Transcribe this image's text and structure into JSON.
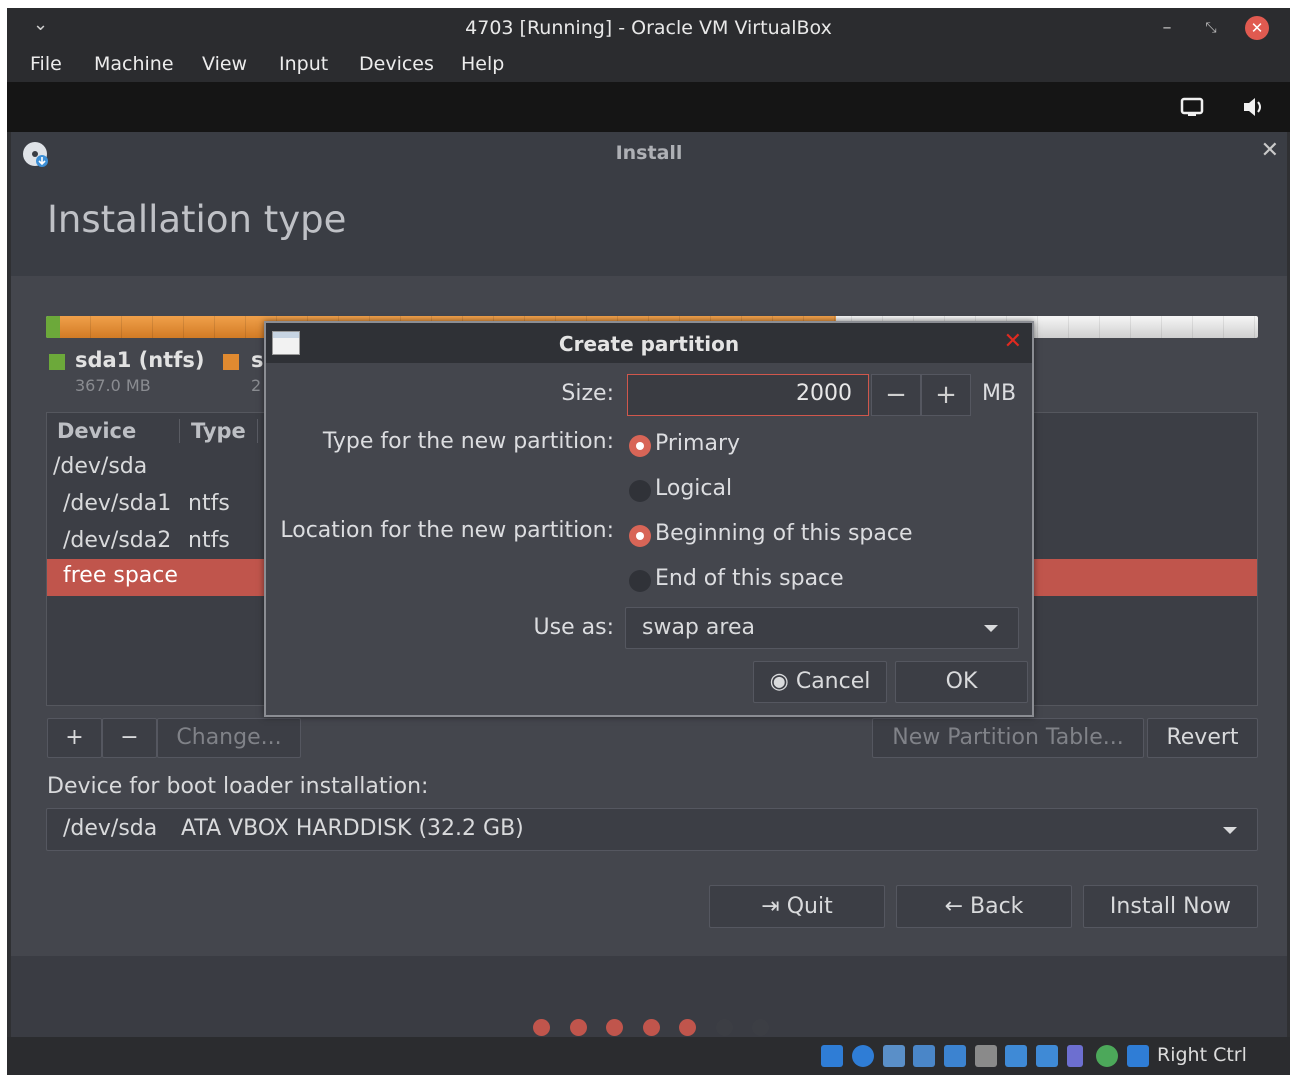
{
  "window": {
    "title": "4703 [Running] - Oracle VM VirtualBox",
    "menu": [
      "File",
      "Machine",
      "View",
      "Input",
      "Devices",
      "Help"
    ]
  },
  "installer": {
    "window_title": "Install",
    "page_title": "Installation type",
    "legend": [
      {
        "label": "sda1 (ntfs)",
        "size": "367.0 MB",
        "color": "#6ca93a"
      },
      {
        "label": "s",
        "size": "2",
        "color": "#e08a30"
      }
    ],
    "table": {
      "headers": [
        "Device",
        "Type"
      ],
      "rows": [
        {
          "device": "/dev/sda",
          "type": ""
        },
        {
          "device": "/dev/sda1",
          "type": "ntfs"
        },
        {
          "device": "/dev/sda2",
          "type": "ntfs"
        },
        {
          "device": "free space",
          "type": ""
        }
      ]
    },
    "buttons": {
      "add": "+",
      "remove": "−",
      "change": "Change...",
      "new_table": "New Partition Table...",
      "revert": "Revert",
      "quit": "Quit",
      "back": "Back",
      "install_now": "Install Now"
    },
    "boot_loader_label": "Device for boot loader installation:",
    "boot_loader_device": "/dev/sda",
    "boot_loader_desc": "ATA VBOX HARDDISK (32.2 GB)"
  },
  "dialog": {
    "title": "Create partition",
    "size_label": "Size:",
    "size_value": "2000",
    "size_unit": "MB",
    "type_label": "Type for the new partition:",
    "type_options": [
      "Primary",
      "Logical"
    ],
    "type_selected": "Primary",
    "location_label": "Location for the new partition:",
    "location_options": [
      "Beginning of this space",
      "End of this space"
    ],
    "location_selected": "Beginning of this space",
    "use_as_label": "Use as:",
    "use_as_value": "swap area",
    "cancel": "Cancel",
    "ok": "OK"
  },
  "statusbar": {
    "host_key": "Right Ctrl"
  },
  "colors": {
    "accent": "#c0554c",
    "selection_red": "#c0554c",
    "dialog_bg": "#44464d"
  }
}
